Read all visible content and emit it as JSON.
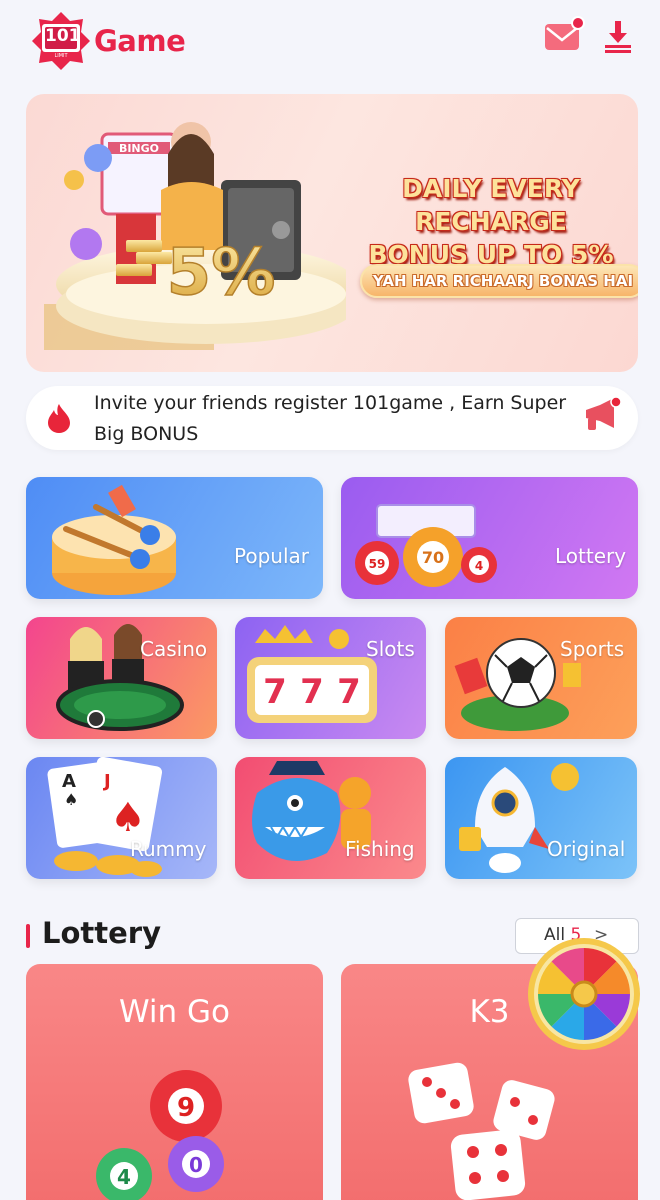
{
  "header": {
    "logo_text": "Game",
    "logo_badge_text": "101",
    "logo_badge_sub": "LIMIT",
    "mail_icon": "mail-icon",
    "download_icon": "download-icon"
  },
  "banner": {
    "title_line1": "DAILY EVERY RECHARGE",
    "title_line2": "BONUS UP TO 5%",
    "subtitle": "YAH HAR RICHAARJ BONAS HAI",
    "bingo_text": "BINGO",
    "percent_text": "5%"
  },
  "notice": {
    "text": "Invite your friends register 101game , Earn Super Big BONUS",
    "left_icon": "fire-icon",
    "right_icon": "megaphone-icon"
  },
  "categories": [
    {
      "label": "Popular",
      "icon": "drum-icon",
      "color_from": "#4f8df5",
      "color_to": "#7db7fa"
    },
    {
      "label": "Lottery",
      "icon": "lottery-balls-icon",
      "color_from": "#9a5cf0",
      "color_to": "#d178f2"
    },
    {
      "label": "Casino",
      "icon": "casino-table-icon",
      "color_from": "#f3458e",
      "color_to": "#fb9a63"
    },
    {
      "label": "Slots",
      "icon": "slot-777-icon",
      "color_from": "#8d63f2",
      "color_to": "#c98af1"
    },
    {
      "label": "Sports",
      "icon": "soccer-ball-icon",
      "color_from": "#fb8046",
      "color_to": "#fda05a"
    },
    {
      "label": "Rummy",
      "icon": "playing-cards-icon",
      "color_from": "#6b87f2",
      "color_to": "#a6b7f8"
    },
    {
      "label": "Fishing",
      "icon": "fish-icon",
      "color_from": "#f24d72",
      "color_to": "#fb8a8c"
    },
    {
      "label": "Original",
      "icon": "rocket-icon",
      "color_from": "#3c96f1",
      "color_to": "#7cc3f8"
    }
  ],
  "lottery_section": {
    "title": "Lottery",
    "all_label": "All",
    "all_count": "5",
    "chevron": ">",
    "games": [
      {
        "title": "Win Go",
        "icon": "lottery-balls-icon",
        "ball_numbers": [
          "9",
          "4",
          "0"
        ]
      },
      {
        "title": "K3",
        "icon": "dice-icon"
      }
    ],
    "wheel_icon": "prize-wheel-icon"
  }
}
